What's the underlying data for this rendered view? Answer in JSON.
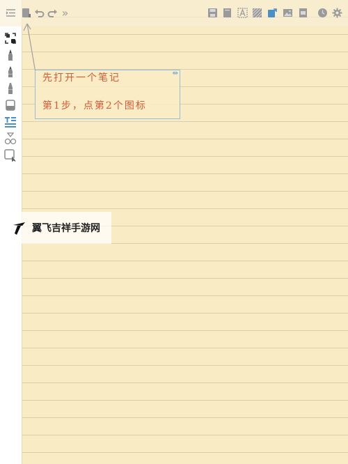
{
  "toolbar": {
    "left_icons": [
      "menu-icon",
      "notebook-icon",
      "undo-icon",
      "redo-icon",
      "more-icon"
    ],
    "right_icons": [
      "save-icon",
      "page-icon",
      "text-recognize-icon",
      "pattern-icon",
      "share-icon",
      "image-icon",
      "export-icon",
      "history-icon",
      "settings-icon"
    ],
    "more_glyph": "»"
  },
  "sidebar": {
    "tools": [
      "select-tool-icon",
      "pen-icon",
      "pencil-icon",
      "marker-icon",
      "eraser-icon",
      "text-tool-icon",
      "shapes-icon",
      "image-tool-icon"
    ]
  },
  "note": {
    "line1": "先打开一个笔记",
    "line2": "第1步，点第2个图标",
    "handle_glyph": "⇹"
  },
  "watermark": {
    "text": "翼飞吉祥手游网"
  },
  "colors": {
    "paper": "#f9ecc4",
    "rule_line": "#d9cfb0",
    "note_text": "#d65a3a",
    "textbox_border": "#8fc0dd",
    "icon_gray": "#9a9a9a",
    "accent_blue": "#4a90c8"
  }
}
